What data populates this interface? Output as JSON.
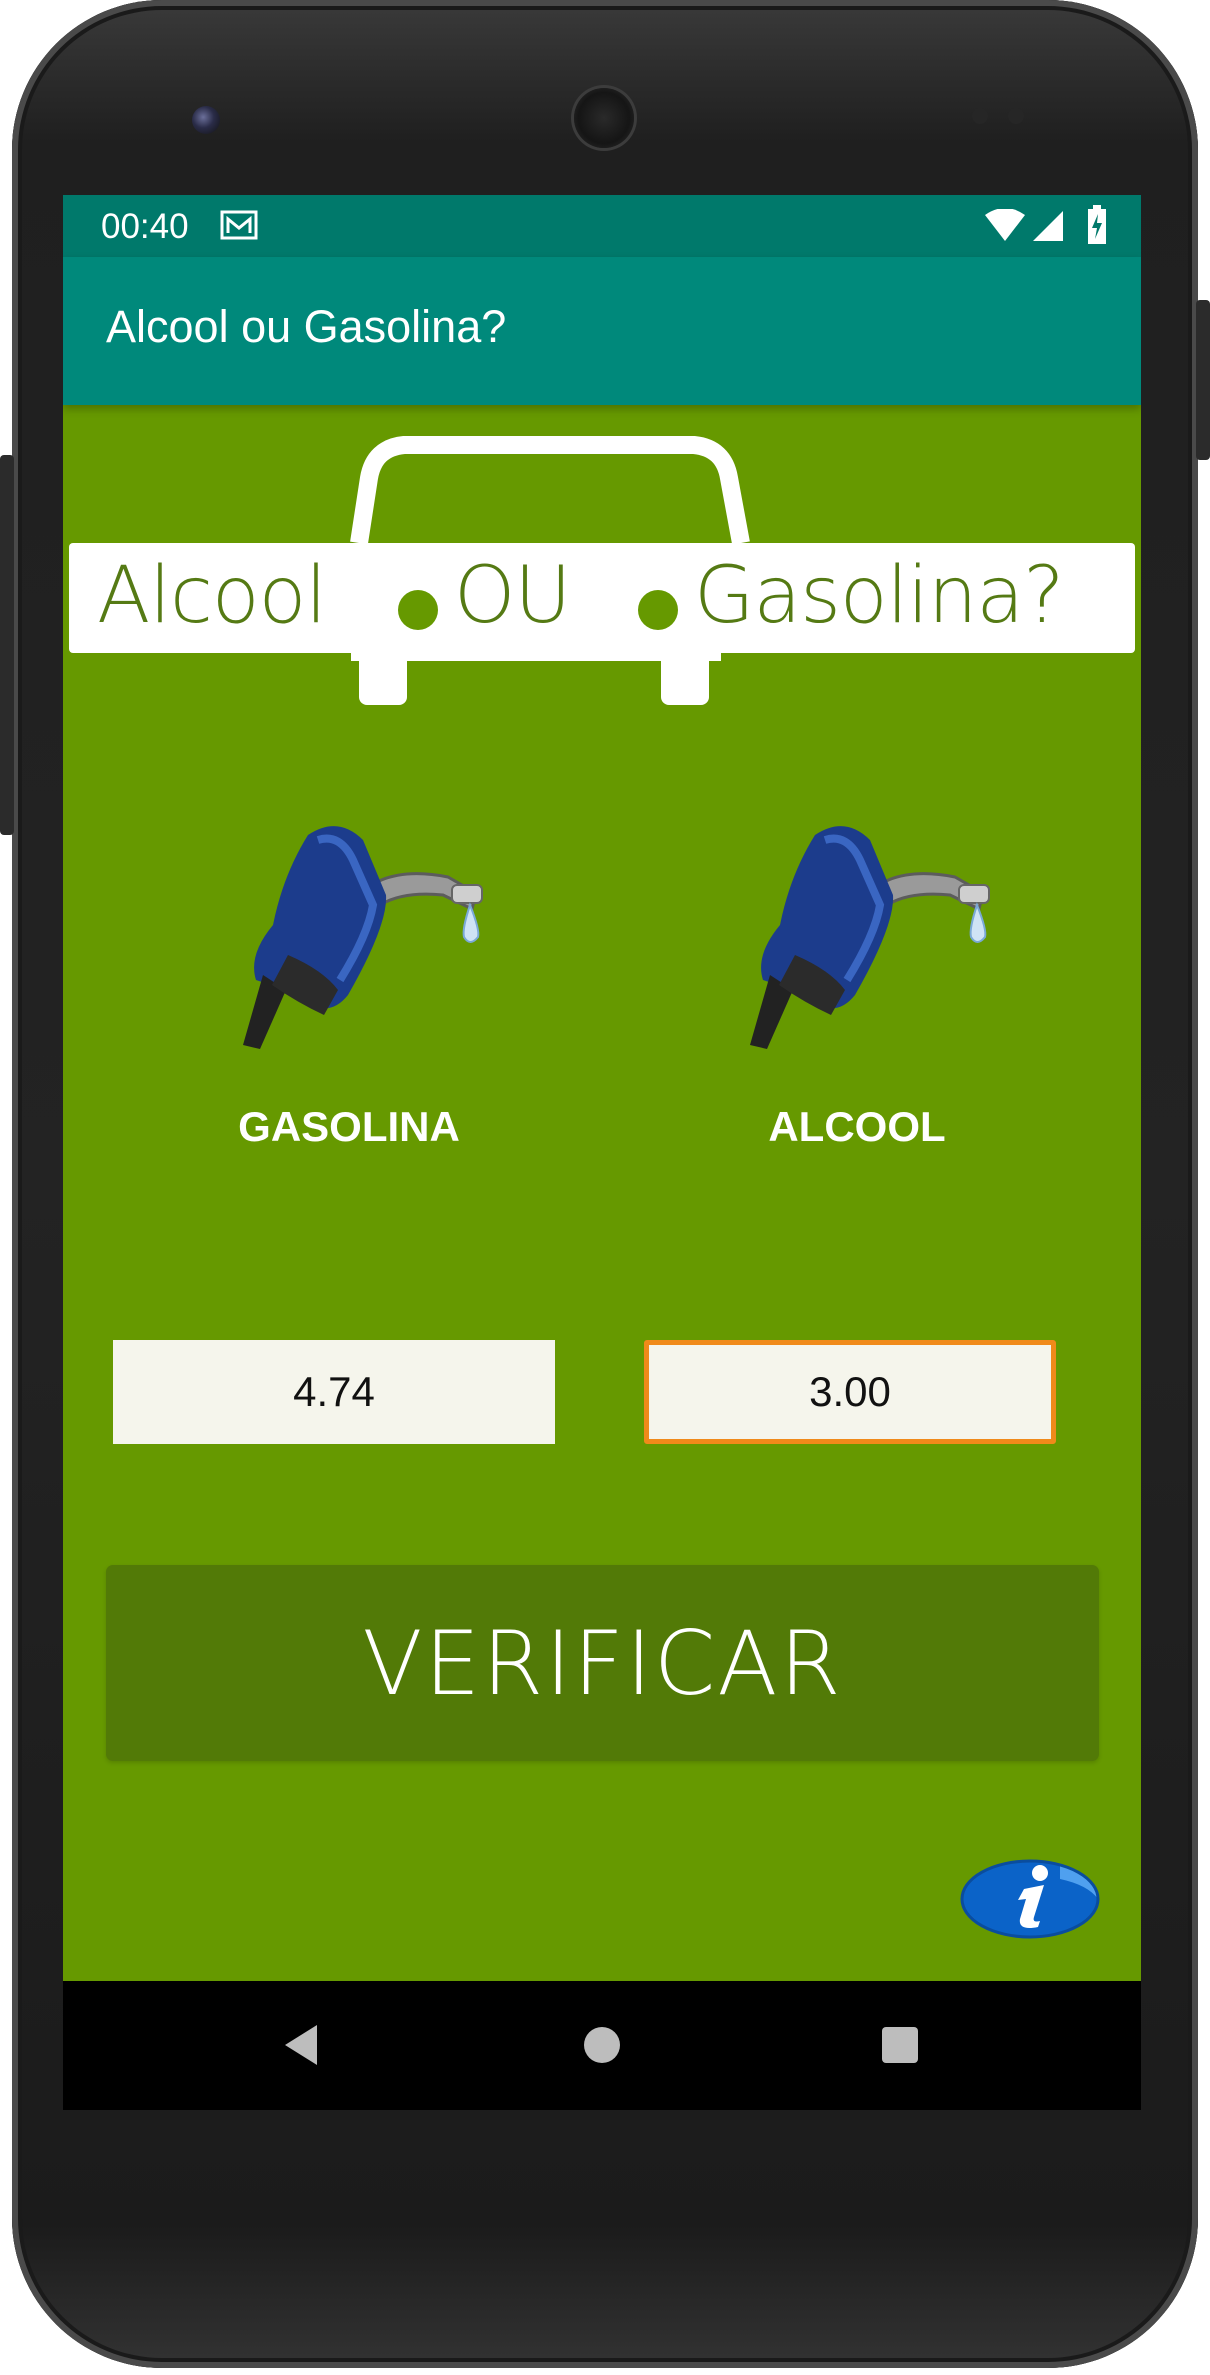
{
  "status_bar": {
    "time": "00:40",
    "icons": [
      "mail-icon",
      "wifi-icon",
      "signal-icon",
      "battery-charging-icon"
    ]
  },
  "app_bar": {
    "title": "Alcool ou Gasolina?"
  },
  "logo": {
    "left_word": "Alcool",
    "middle_word": "OU",
    "right_word": "Gasolina?"
  },
  "fuels": {
    "gasoline": {
      "label": "GASOLINA",
      "value": "4.74",
      "icon": "fuel-pump-icon"
    },
    "alcohol": {
      "label": "ALCOOL",
      "value": "3.00",
      "icon": "fuel-pump-icon"
    }
  },
  "actions": {
    "verify_label": "VERIFICAR",
    "info_icon": "info-icon"
  },
  "nav_bar": {
    "icons": [
      "back-icon",
      "home-icon",
      "recents-icon"
    ]
  },
  "colors": {
    "status_bar": "#00796b",
    "app_bar": "#00897b",
    "background": "#669900",
    "button": "#527a07",
    "focus_border": "#f08a1a"
  }
}
